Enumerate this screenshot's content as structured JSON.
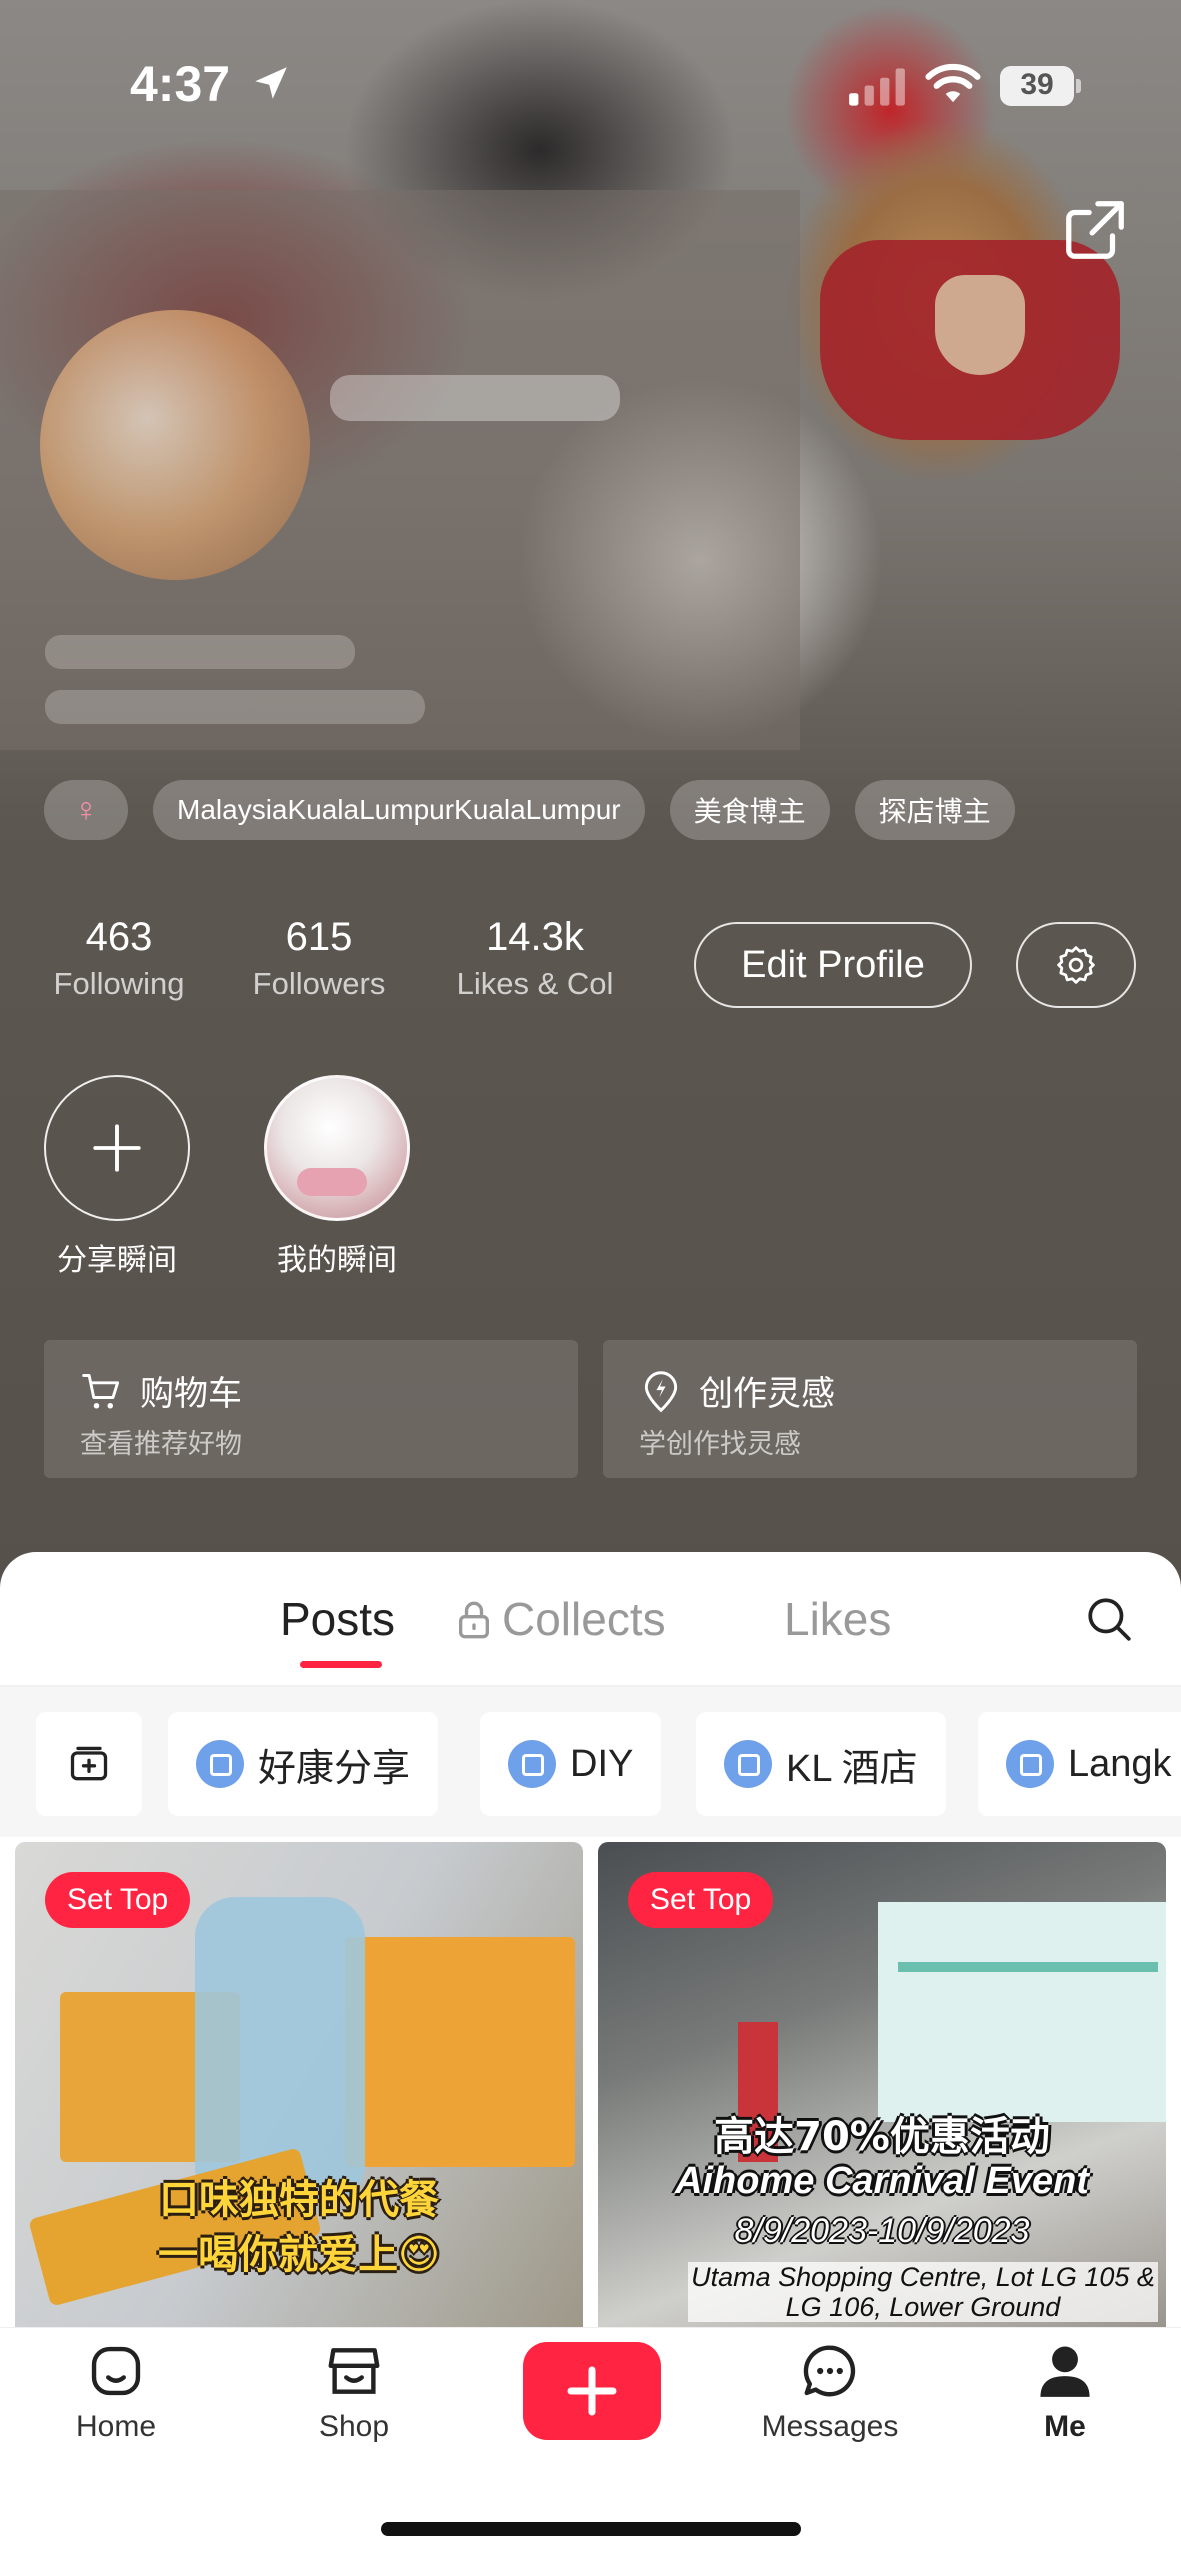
{
  "status_bar": {
    "time": "4:37",
    "battery": "39"
  },
  "profile": {
    "tags": [
      "MalaysiaKualaLumpurKualaLumpur",
      "美食博主",
      "探店博主"
    ],
    "stats": [
      {
        "value": "463",
        "label": "Following"
      },
      {
        "value": "615",
        "label": "Followers"
      },
      {
        "value": "14.3k",
        "label": "Likes & Col"
      }
    ],
    "edit_label": "Edit Profile"
  },
  "moments": {
    "share": "分享瞬间",
    "mine": "我的瞬间"
  },
  "cards": [
    {
      "title": "购物车",
      "subtitle": "查看推荐好物"
    },
    {
      "title": "创作灵感",
      "subtitle": "学创作找灵感"
    }
  ],
  "tabs": {
    "posts": "Posts",
    "collects": "Collects",
    "likes": "Likes"
  },
  "chips": [
    "好康分享",
    "DIY",
    "KL 酒店",
    "Langk"
  ],
  "posts": [
    {
      "badge": "Set Top",
      "caption_1": "口味独特的代餐",
      "caption_2": "一喝你就爱上😍"
    },
    {
      "badge": "Set Top",
      "caption_1": "高达70%优惠活动",
      "caption_2": "Aihome Carnival Event",
      "caption_3": "8/9/2023-10/9/2023",
      "caption_4": "Utama Shopping Centre, Lot LG 105 & LG 106, Lower Ground"
    }
  ],
  "nav": {
    "home": "Home",
    "shop": "Shop",
    "messages": "Messages",
    "me": "Me"
  },
  "colors": {
    "accent": "#ff2442",
    "chip_icon": "#6fa0ea"
  }
}
